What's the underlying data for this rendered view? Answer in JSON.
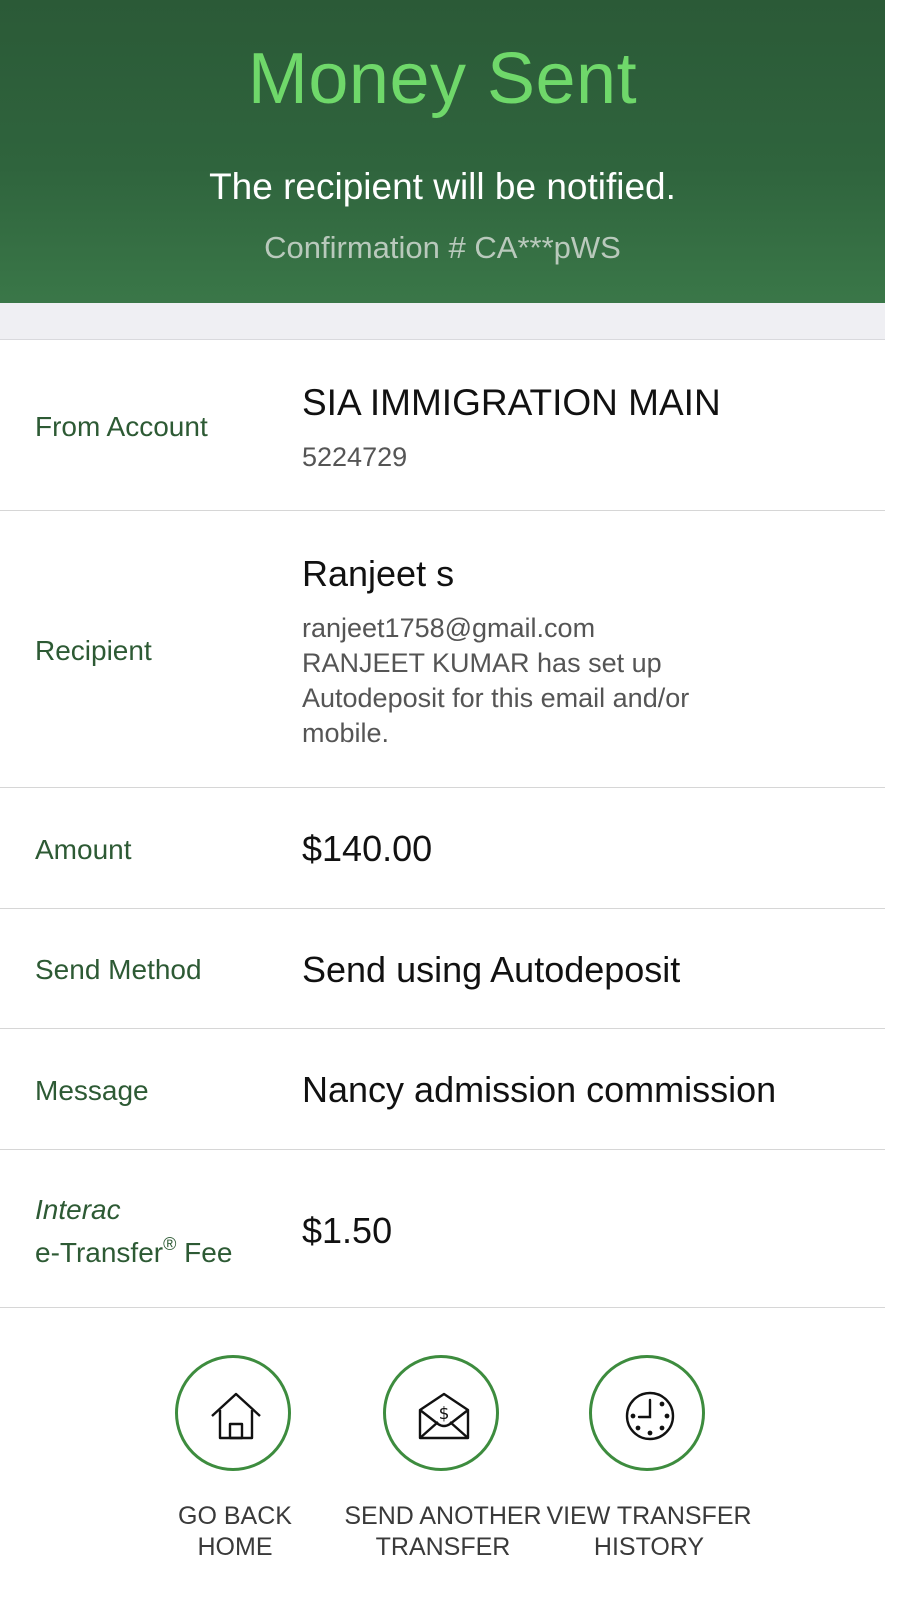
{
  "header": {
    "title": "Money Sent",
    "subtitle": "The recipient will be notified.",
    "confirmation": "Confirmation # CA***pWS"
  },
  "rows": {
    "from_account": {
      "label": "From Account",
      "name": "SIA IMMIGRATION MAIN",
      "number": "5224729"
    },
    "recipient": {
      "label": "Recipient",
      "name": "Ranjeet s",
      "email": "ranjeet1758@gmail.com",
      "note_line1": "RANJEET KUMAR has set up",
      "note_line2": "Autodeposit for this email and/or",
      "note_line3": "mobile."
    },
    "amount": {
      "label": "Amount",
      "value": "$140.00"
    },
    "send_method": {
      "label": "Send Method",
      "value": "Send using Autodeposit"
    },
    "message": {
      "label": "Message",
      "value": "Nancy admission commission"
    },
    "fee": {
      "label_line1": "Interac",
      "label_line2": "e-Transfer",
      "label_reg": "®",
      "label_suffix": " Fee",
      "value": "$1.50"
    }
  },
  "actions": [
    {
      "line1": "GO BACK",
      "line2": "HOME",
      "icon": "home-icon"
    },
    {
      "line1": "SEND ANOTHER",
      "line2": "TRANSFER",
      "icon": "envelope-dollar-icon"
    },
    {
      "line1": "VIEW TRANSFER",
      "line2": "HISTORY",
      "icon": "clock-icon"
    }
  ],
  "colors": {
    "header_bg": "#2f643d",
    "title_green": "#6fd86a",
    "label_green": "#2d5a34",
    "button_ring": "#3d8c3e"
  }
}
